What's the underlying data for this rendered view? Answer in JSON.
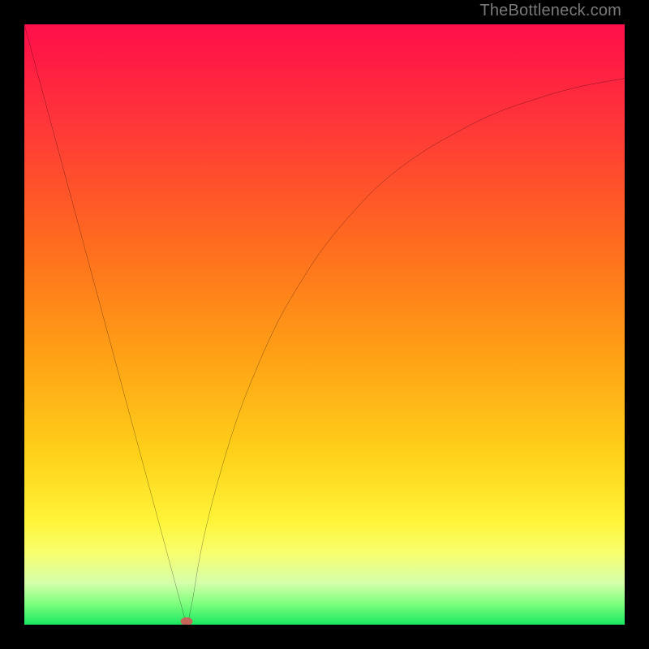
{
  "watermark": "TheBottleneck.com",
  "chart_data": {
    "type": "line",
    "title": "",
    "xlabel": "",
    "ylabel": "",
    "xlim": [
      0,
      100
    ],
    "ylim": [
      0,
      100
    ],
    "grid": false,
    "legend": false,
    "background_gradient": {
      "orientation": "vertical",
      "stops": [
        {
          "pos": 0.0,
          "color": "#ff104a"
        },
        {
          "pos": 0.18,
          "color": "#ff3a37"
        },
        {
          "pos": 0.36,
          "color": "#ff6a1f"
        },
        {
          "pos": 0.55,
          "color": "#ffa015"
        },
        {
          "pos": 0.72,
          "color": "#ffd21a"
        },
        {
          "pos": 0.83,
          "color": "#fff53a"
        },
        {
          "pos": 0.93,
          "color": "#d6ffaa"
        },
        {
          "pos": 1.0,
          "color": "#18e860"
        }
      ]
    },
    "series": [
      {
        "name": "curve",
        "color": "#000000",
        "x": [
          0.0,
          2.7,
          5.4,
          8.1,
          10.8,
          13.5,
          16.2,
          18.9,
          21.6,
          24.3,
          27.0,
          27.2,
          27.4,
          27.6,
          28.0,
          28.5,
          29.0,
          30.0,
          32.0,
          35.0,
          38.0,
          42.0,
          46.0,
          50.0,
          55.0,
          60.0,
          66.0,
          72.0,
          78.0,
          85.0,
          92.0,
          100.0
        ],
        "y": [
          100.0,
          90.0,
          80.0,
          70.0,
          60.0,
          50.0,
          40.0,
          30.0,
          20.0,
          10.0,
          0.0,
          0.5,
          1.0,
          2.0,
          4.0,
          7.0,
          10.0,
          15.0,
          23.0,
          33.0,
          41.0,
          50.0,
          57.0,
          63.0,
          69.0,
          74.0,
          78.5,
          82.0,
          85.0,
          87.5,
          89.5,
          91.0
        ]
      }
    ],
    "marker": {
      "x": 27.0,
      "y": 0.5,
      "color": "#d25a5a"
    }
  }
}
